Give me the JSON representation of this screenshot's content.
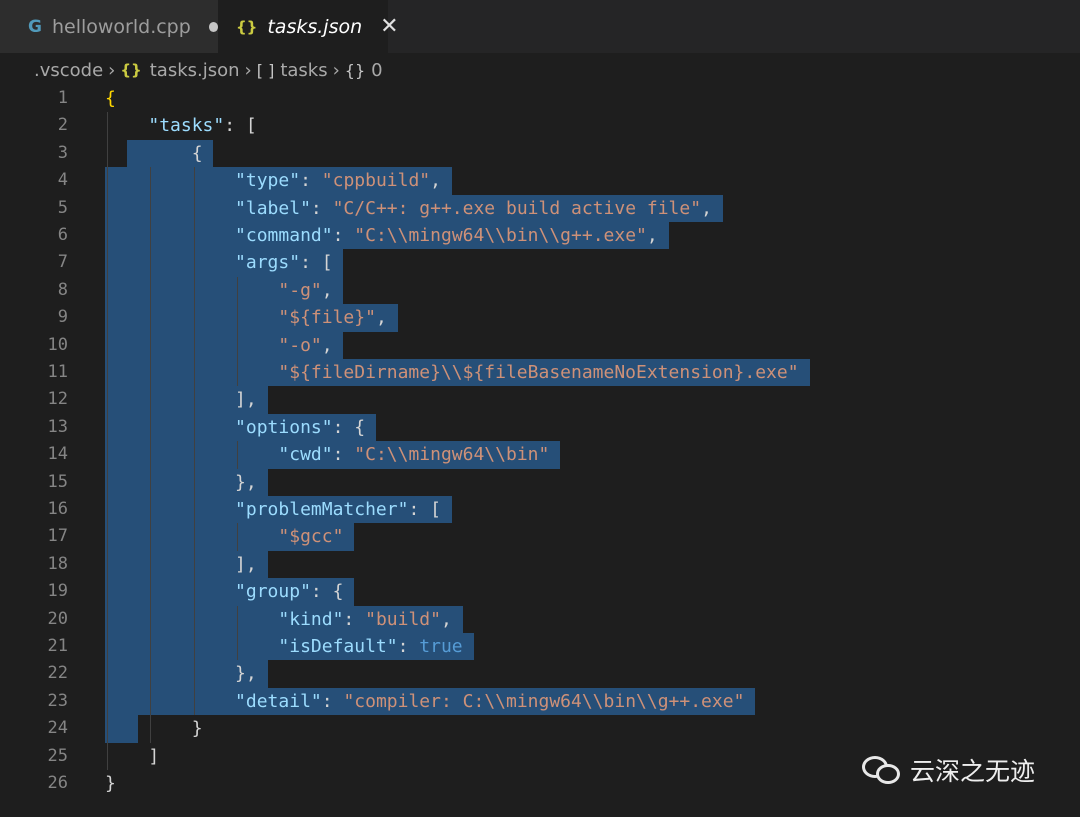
{
  "tabs": [
    {
      "label": "helloworld.cpp",
      "icon": "cpp-file-icon",
      "active": false,
      "modified": true
    },
    {
      "label": "tasks.json",
      "icon": "json-file-icon",
      "active": true,
      "close": "✕"
    }
  ],
  "breadcrumb": {
    "folder": ".vscode",
    "file": "tasks.json",
    "array": "tasks",
    "object": "0",
    "array_symbol": "[ ]",
    "object_symbol": "{}"
  },
  "lines": [
    "{",
    "    \"tasks\": [",
    "        {",
    "            \"type\": \"cppbuild\",",
    "            \"label\": \"C/C++: g++.exe build active file\",",
    "            \"command\": \"C:\\\\mingw64\\\\bin\\\\g++.exe\",",
    "            \"args\": [",
    "                \"-g\",",
    "                \"${file}\",",
    "                \"-o\",",
    "                \"${fileDirname}\\\\${fileBasenameNoExtension}.exe\"",
    "            ],",
    "            \"options\": {",
    "                \"cwd\": \"C:\\\\mingw64\\\\bin\"",
    "            },",
    "            \"problemMatcher\": [",
    "                \"$gcc\"",
    "            ],",
    "            \"group\": {",
    "                \"kind\": \"build\",",
    "                \"isDefault\": true",
    "            },",
    "            \"detail\": \"compiler: C:\\\\mingw64\\\\bin\\\\g++.exe\"",
    "        }",
    "    ]",
    "}"
  ],
  "watermark": {
    "text": "云深之无迹",
    "icon": "wechat-icon"
  },
  "colors": {
    "background": "#1e1e1e",
    "selection": "#264f78",
    "key": "#9cdcfe",
    "string": "#ce9178",
    "boolean": "#569cd6",
    "line_number": "#858585"
  }
}
